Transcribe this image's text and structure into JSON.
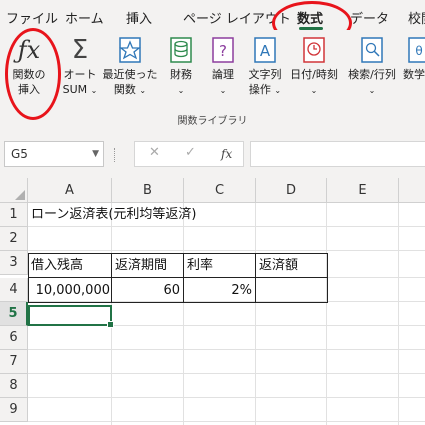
{
  "menu": {
    "items": [
      "ファイル",
      "ホーム",
      "挿入",
      "ページ レイアウト",
      "数式",
      "データ",
      "校閲"
    ],
    "active": "数式"
  },
  "ribbon": {
    "buttons": [
      {
        "label1": "関数の",
        "label2": "挿入",
        "icon": "fx-icon"
      },
      {
        "label1": "オート",
        "label2": "SUM",
        "icon": "sigma-icon",
        "caret": "⌄"
      },
      {
        "label1": "最近使った",
        "label2": "関数",
        "icon": "star-icon",
        "caret": "⌄"
      },
      {
        "label1": "財務",
        "label2": "",
        "icon": "database-icon",
        "caret": "⌄"
      },
      {
        "label1": "論理",
        "label2": "",
        "icon": "question-book-icon",
        "caret": "⌄"
      },
      {
        "label1": "文字列",
        "label2": "操作",
        "icon": "text-book-icon",
        "caret": "⌄"
      },
      {
        "label1": "日付/時刻",
        "label2": "",
        "icon": "clock-book-icon",
        "caret": "⌄"
      },
      {
        "label1": "検索/行列",
        "label2": "",
        "icon": "search-book-icon",
        "caret": "⌄"
      },
      {
        "label1": "数学",
        "label2": "",
        "icon": "math-book-icon"
      }
    ],
    "group_label": "関数ライブラリ"
  },
  "formula_bar": {
    "name_box": "G5",
    "cancel": "✕",
    "enter": "✓",
    "fx": "fx",
    "value": ""
  },
  "sheet": {
    "columns": [
      "A",
      "B",
      "C",
      "D",
      "E"
    ],
    "rows": [
      "1",
      "2",
      "3",
      "4",
      "5",
      "6",
      "7",
      "8",
      "9"
    ],
    "selected_row": "5",
    "cells": {
      "A1": "ローン返済表(元利均等返済)",
      "A3": "借入残高",
      "B3": "返済期間",
      "C3": "利率",
      "D3": "返済額",
      "A4": "10,000,000",
      "B4": "60",
      "C4": "2%",
      "D4": ""
    }
  },
  "colors": {
    "accent": "#217346",
    "annotation": "#e8141b"
  }
}
